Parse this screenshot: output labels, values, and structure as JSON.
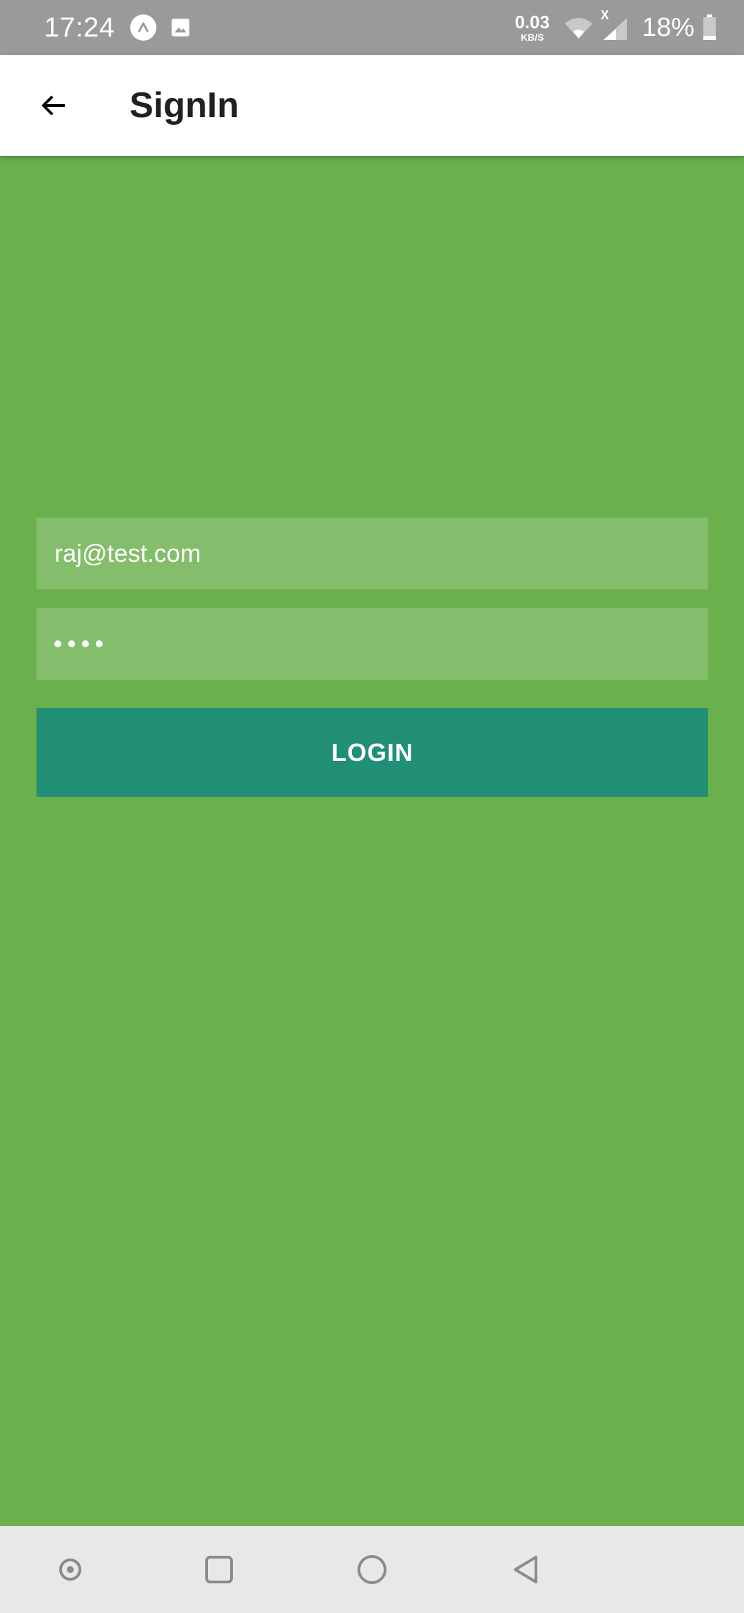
{
  "status_bar": {
    "time": "17:24",
    "net_speed_value": "0.03",
    "net_speed_unit": "KB/S",
    "signal_badge": "X",
    "battery_percent": "18%",
    "battery_level": 0.18,
    "icons": [
      "app-notification-icon",
      "image-notification-icon",
      "wifi-icon",
      "signal-icon",
      "battery-icon"
    ]
  },
  "app_bar": {
    "title": "SignIn",
    "back_icon": "arrow-left-icon"
  },
  "form": {
    "email_value": "raj@test.com",
    "password_length": 4,
    "password_mask": "••••",
    "login_label": "LOGIN"
  },
  "nav_bar": {
    "icons": [
      "assistant-icon",
      "recents-icon",
      "home-icon",
      "back-icon"
    ]
  },
  "colors": {
    "background": "#6ab04c",
    "status_bar": "#9a9a9a",
    "app_bar": "#ffffff",
    "field_bg": "rgba(255,255,255,0.18)",
    "button": "#218f76",
    "nav_bar": "#e8e8e8"
  }
}
